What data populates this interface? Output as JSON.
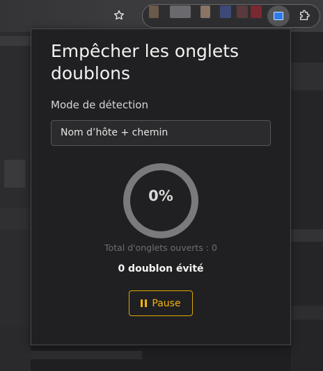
{
  "toolbar": {
    "bookmark_icon": "star-outline-icon",
    "active_extension_icon": "tab-icon",
    "extensions_icon": "puzzle-icon"
  },
  "popup": {
    "title": "Empêcher les onglets doublons",
    "mode_label": "Mode de détection",
    "mode_value": "Nom d’hôte + chemin",
    "progress": {
      "label": "0%",
      "value": 0
    },
    "total_tabs": "Total d'onglets ouverts : 0",
    "duplicates_avoided": "0 doublon évité",
    "pause_label": "Pause",
    "colors": {
      "accent": "#f2b40a",
      "ring": "#7a7a7c",
      "background": "#202022"
    }
  }
}
